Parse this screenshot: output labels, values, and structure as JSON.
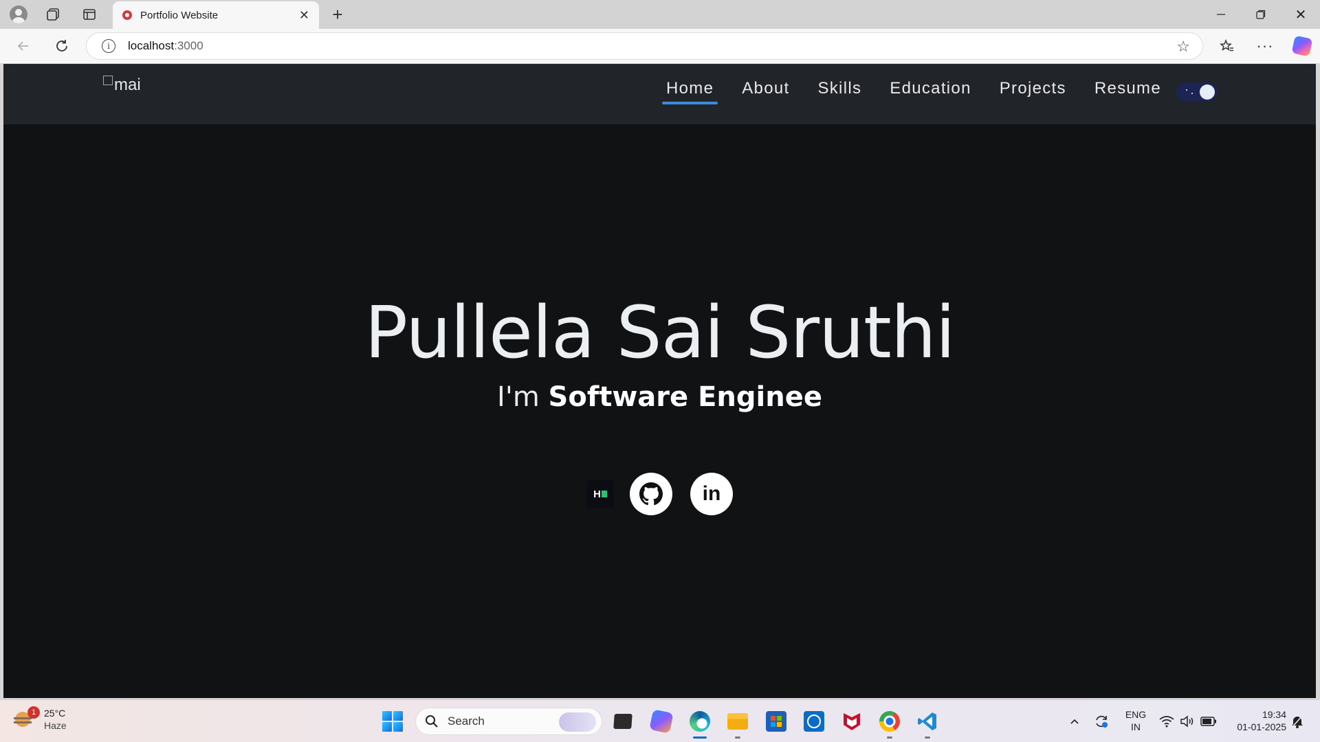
{
  "browser": {
    "tab_title": "Portfolio Website",
    "url_host": "localhost",
    "url_port": ":3000",
    "icons": {
      "profile": "profile-icon",
      "workspaces": "workspaces-icon",
      "tab_actions": "tab-actions-icon",
      "close_tab": "close-icon",
      "new_tab": "plus-icon",
      "back": "back-arrow-icon",
      "reload": "reload-icon",
      "site_info": "info-icon",
      "favorite": "star-icon",
      "favorites": "favorites-icon",
      "more": "more-icon",
      "copilot": "copilot-icon"
    }
  },
  "site": {
    "logo_alt": "mai",
    "nav": [
      {
        "label": "Home",
        "active": true
      },
      {
        "label": "About",
        "active": false
      },
      {
        "label": "Skills",
        "active": false
      },
      {
        "label": "Education",
        "active": false
      },
      {
        "label": "Projects",
        "active": false
      },
      {
        "label": "Resume",
        "active": false
      }
    ],
    "theme_toggle": {
      "state": "dark",
      "icon": "theme-toggle"
    },
    "hero": {
      "name": "Pullela Sai Sruthi",
      "prefix": "I'm ",
      "role": "Software Enginee"
    },
    "socials": [
      {
        "name": "hackerrank",
        "label": "H"
      },
      {
        "name": "github",
        "icon": "github-icon"
      },
      {
        "name": "linkedin",
        "label": "in"
      }
    ],
    "colors": {
      "navbar": "#212429",
      "background": "#111214",
      "active_underline": "#3d8be0"
    }
  },
  "taskbar": {
    "weather": {
      "temp": "25°C",
      "condition": "Haze",
      "badge": "1"
    },
    "search_placeholder": "Search",
    "language": {
      "line1": "ENG",
      "line2": "IN"
    },
    "time": "19:34",
    "date": "01-01-2025"
  }
}
